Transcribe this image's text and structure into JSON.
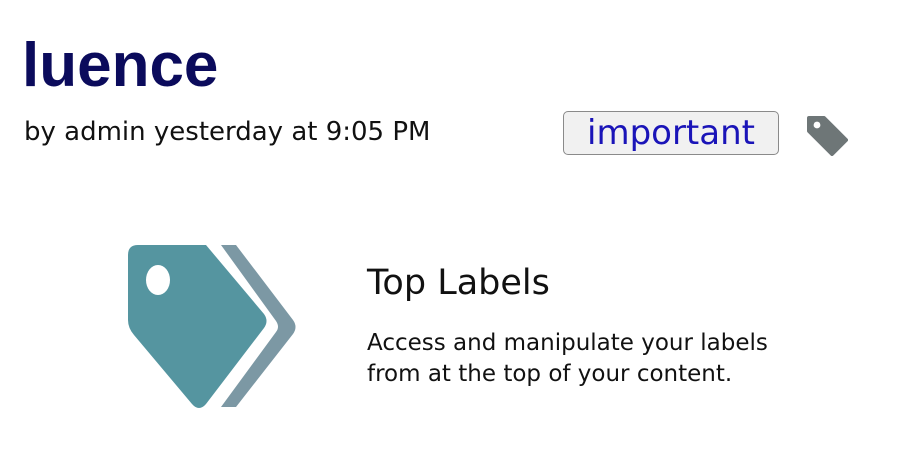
{
  "page": {
    "title": "luence",
    "byline": "by admin yesterday at 9:05 PM"
  },
  "labels": {
    "items": [
      {
        "label": "important"
      }
    ],
    "tag_icon": "tag-icon"
  },
  "feature": {
    "icon": "labels-icon",
    "title": "Top Labels",
    "description_lines": [
      "Access and manipulate your labels",
      "from at the top of your content."
    ]
  },
  "colors": {
    "title": "#0b0b5c",
    "label_text": "#1a14b8",
    "label_bg": "#f1f1f1",
    "tag_icon": "#6e7677",
    "hero_front": "#5595a0",
    "hero_back": "#7c98a4"
  }
}
